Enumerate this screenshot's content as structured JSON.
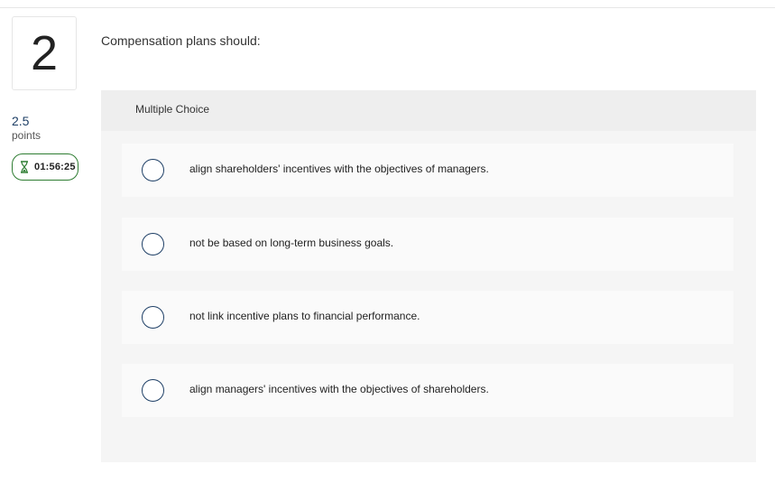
{
  "question": {
    "number": "2",
    "points_value": "2.5",
    "points_label": "points",
    "timer": "01:56:25",
    "text": "Compensation plans should:"
  },
  "answer_panel": {
    "header": "Multiple Choice",
    "choices": [
      {
        "label": "align shareholders' incentives with the objectives of managers."
      },
      {
        "label": "not be based on long-term business goals."
      },
      {
        "label": "not link incentive plans to financial performance."
      },
      {
        "label": "align managers' incentives with the objectives of shareholders."
      }
    ]
  },
  "colors": {
    "accent": "#1e3f66",
    "timer_border": "#2e7d32",
    "panel_bg": "#f5f5f5",
    "panel_header_bg": "#eeeeee",
    "choice_bg": "#fafafa"
  },
  "icons": {
    "timer": "hourglass-icon",
    "choice": "radio-button"
  }
}
